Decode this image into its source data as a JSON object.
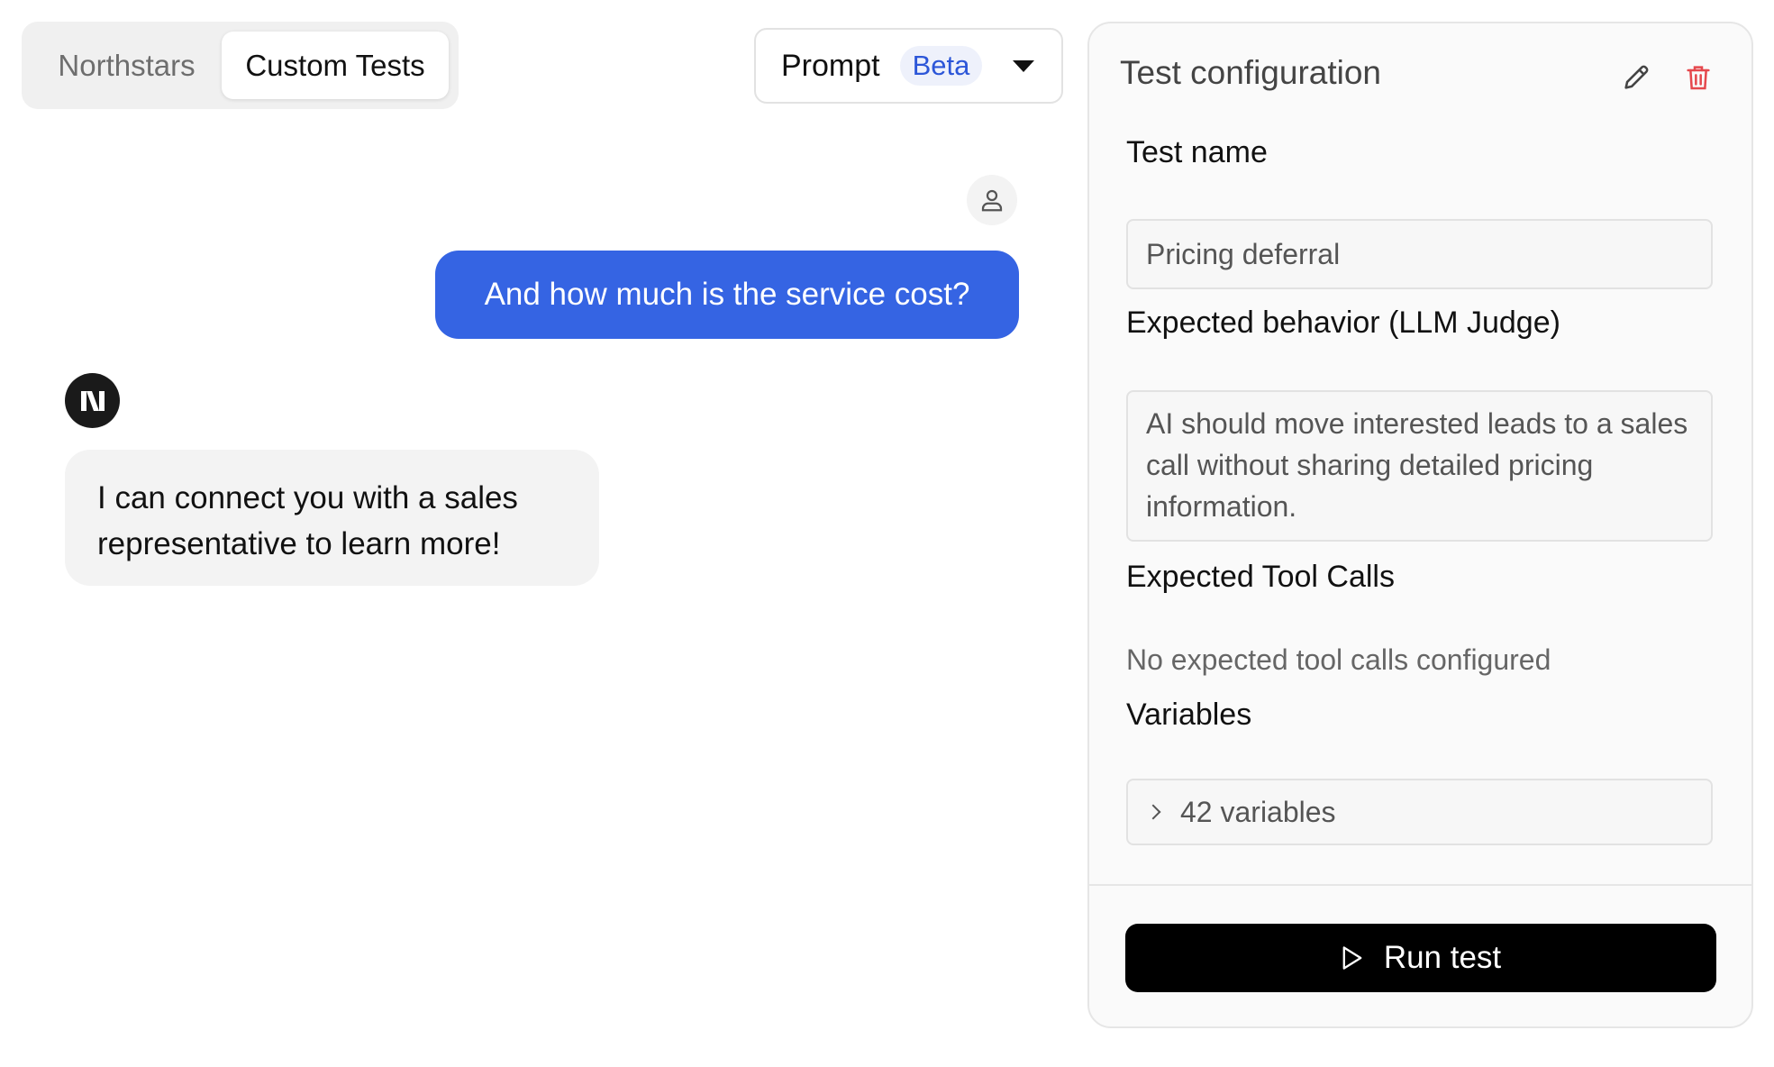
{
  "tabs": [
    {
      "label": "Northstars",
      "active": false
    },
    {
      "label": "Custom Tests",
      "active": true
    }
  ],
  "prompt_select": {
    "label": "Prompt",
    "badge": "Beta"
  },
  "chat": {
    "user_message": "And how much is the service cost?",
    "bot_message": "I can connect you with a sales representative to learn more!"
  },
  "panel": {
    "title": "Test configuration",
    "test_name_label": "Test name",
    "test_name_value": "Pricing deferral",
    "behavior_label": "Expected behavior (LLM Judge)",
    "behavior_value": "AI should move interested leads to a sales call without sharing detailed pricing information.",
    "tools_label": "Expected Tool Calls",
    "tools_empty": "No expected tool calls configured",
    "variables_label": "Variables",
    "variables_summary": "42 variables",
    "run_button_label": "Run test"
  },
  "colors": {
    "accent_blue": "#3564e3",
    "beta_text": "#2c56d8",
    "delete_red": "#e5484d",
    "run_button_bg": "#000000"
  },
  "icons": {
    "user": "user-icon",
    "bot": "bot-logo-icon",
    "edit": "pencil-icon",
    "delete": "trash-icon",
    "caret": "caret-down-icon",
    "chevron": "chevron-right-icon",
    "play": "play-icon"
  }
}
